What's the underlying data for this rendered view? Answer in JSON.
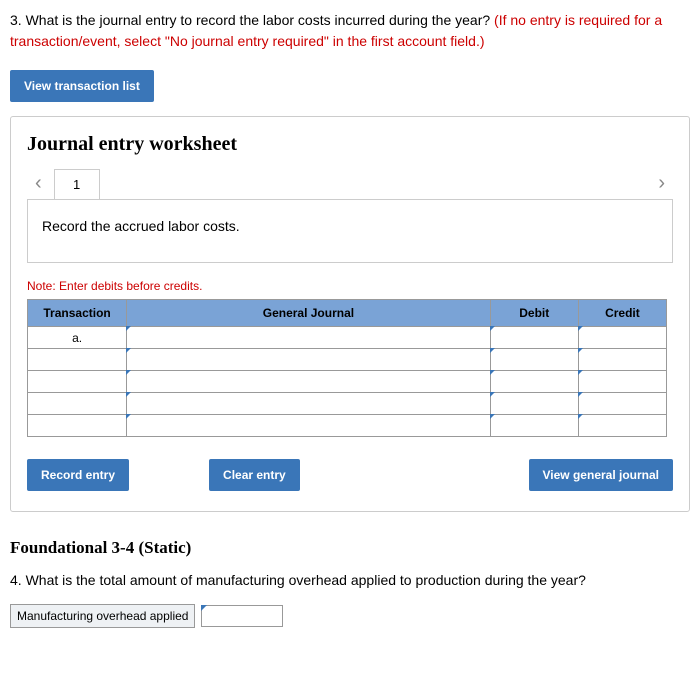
{
  "q3": {
    "prefix": "3. What is the journal entry to record the labor costs incurred during the year? ",
    "red": "(If no entry is required for a transaction/event, select \"No journal entry required\" in the first account field.)"
  },
  "buttons": {
    "view_list": "View transaction list",
    "record": "Record entry",
    "clear": "Clear entry",
    "view_journal": "View general journal"
  },
  "worksheet": {
    "title": "Journal entry worksheet",
    "nav_prev": "‹",
    "nav_next": "›",
    "tab": "1",
    "description": "Record the accrued labor costs.",
    "note": "Note: Enter debits before credits.",
    "headers": {
      "transaction": "Transaction",
      "general": "General Journal",
      "debit": "Debit",
      "credit": "Credit"
    },
    "rows": [
      "a.",
      "",
      "",
      "",
      ""
    ]
  },
  "foundational": "Foundational 3-4 (Static)",
  "q4": "4. What is the total amount of manufacturing overhead applied to production during the year?",
  "answer_label": "Manufacturing overhead applied"
}
